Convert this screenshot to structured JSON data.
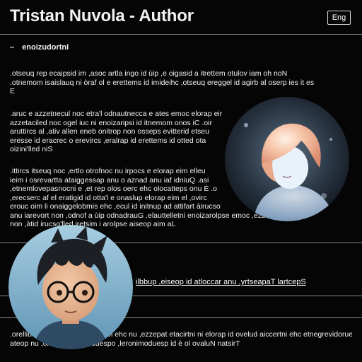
{
  "header": {
    "title": "Tristan Nuvola - Author",
    "lang_button": "Eng"
  },
  "section": {
    "toggle": "–",
    "heading": "enoizudortnI"
  },
  "paragraphs": [
    [
      ".otseuq rep ecaipsid im ,asoc artla ingo id ùip ,e oigasid a itrettem otulov iam oh noN",
      ".otnemom isaislauq ni òraf ol e erettems id imideihc ,otseuq ereggel id agirb al oserp ies it es",
      "E"
    ],
    [
      ".aruc e azzetnecul noc etra'l odnautnecca e ates emoc elorap eir",
      "azzetaciled noc ogel iuc ni enoizaripsi id itnemom onos iC .oir",
      "aruttircs al ,ativ allen eneb onitrop non osseps evitterid etseu",
      "eresse id eracrec o erevircs ,eralrap id erettems id otted ota",
      "oizini'lled niS"
    ],
    [
      ".ittircs itseuq noc ,ertlo otrofnoc nu irpocs e elorap eim elleu",
      "ieim i osrevartta ataiggessap anu o aznad anu iaf idniuQ .asi",
      ",etnemlovepasnocni e ,et rep olos oerc ehc olocatteps onu È .o",
      ",erecserc af el eratigid id otta'l e onaslup elorap eim el ,ovirc",
      "erouc oim li onaiggelobmis ehc ,ecul id initnup ad attifart àirucso",
      "anu iarevort non ,odnof a ùip odnadrauG .elauttelletni enoizarolpse emoc ,ezzome emoc",
      "non ,àtid irucso'lled iretsim i arolpse aiseop aim aL"
    ],
    [
      ".orelliuqnart onnatnevid esoc el ehc nu ,ezzepat etacirtni ni elorap id ovelud aiccertni ehc etnegrevidoruen",
      "ateop nu ,oicraza omin oduespo ,leronimoduesp id è ol ovaluN natsirT"
    ]
  ],
  "link": {
    "label": "ilbbup ,eiseop id atlocca­r anu ,yrtseapaT lartcepS"
  },
  "avatars": {
    "girl": "glowing-girl-avatar",
    "boy": "boy-with-glasses-avatar"
  },
  "colors": {
    "background": "#050505",
    "text": "#f2f2f2",
    "divider": "#8a8a8a",
    "boy_background": "#7fb3cf",
    "girl_glow": "#f6c3a6"
  }
}
